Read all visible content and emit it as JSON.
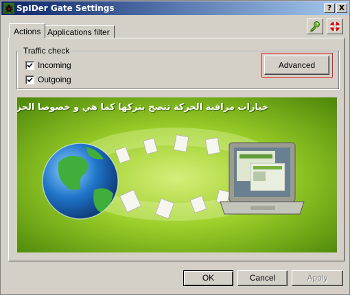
{
  "window": {
    "title": "SpIDer Gate Settings",
    "help_label": "?",
    "close_label": "X"
  },
  "tabs": [
    {
      "label": "Actions"
    },
    {
      "label": "Applications filter"
    }
  ],
  "toolbar": {
    "key_icon": "key-icon",
    "help_icon": "lifebuoy-icon"
  },
  "traffic_check": {
    "group_label": "Traffic check",
    "incoming_label": "Incoming",
    "incoming_checked": true,
    "outgoing_label": "Outgoing",
    "outgoing_checked": true,
    "advanced_label": "Advanced"
  },
  "banner": {
    "caption": "خيارات مراقبة الحركة تنصح بتركها كما هي و خصوصا الحزم القادمة",
    "icons": [
      "globe-icon",
      "document-icon",
      "laptop-icon"
    ]
  },
  "buttons": {
    "ok": "OK",
    "cancel": "Cancel",
    "apply": "Apply"
  },
  "colors": {
    "title_start": "#0a246a",
    "title_end": "#a6caf0",
    "banner_green": "#8bbf1a",
    "highlight_red": "#e02020"
  }
}
